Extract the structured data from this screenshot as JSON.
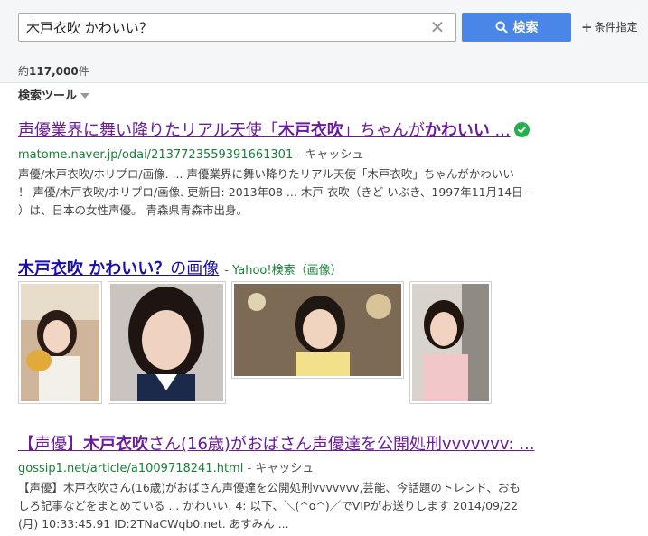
{
  "search": {
    "query": "木戸衣吹 かわいい？",
    "button_label": "検索",
    "conditions_label": "条件指定"
  },
  "results_count": {
    "prefix": "約",
    "number": "117,000",
    "suffix": "件"
  },
  "search_tools_label": "検索ツール",
  "results": [
    {
      "title_pre": "声優業界に舞い降りたリアル天使「",
      "title_b1": "木戸衣吹",
      "title_mid": "」ちゃんが",
      "title_b2": "かわいい",
      "title_post": " ...",
      "url": "matome.naver.jp/odai/2137723559391661301",
      "cache": "キャッシュ",
      "snippet": [
        "声優/木戸衣吹/ホリプロ/画像. ... 声優業界に舞い降りたリアル天使「木戸衣吹」ちゃんがかわいい",
        "！ 声優/木戸衣吹/ホリプロ/画像. 更新日: 2013年08 ... 木戸 衣吹（きど いぶき、1997年11月14日 -",
        "）は、日本の女性声優。 青森県青森市出身。"
      ]
    },
    {
      "title_pre": "【声優】",
      "title_b1": "木戸衣吹",
      "title_mid": "さん(16歳)がおばさん声優達を公開処刑vvvvvvv: ...",
      "url": "gossip1.net/article/a1009718241.html",
      "cache": "キャッシュ",
      "snippet": [
        "【声優】木戸衣吹さん(16歳)がおばさん声優達を公開処刑vvvvvvv,芸能、今話題のトレンド、おも",
        "しろ記事などをまとめている ... かわいい. 4: 以下、＼(^o^)／でVIPがお送りします 2014/09/22",
        "(月) 10:33:45.91 ID:2TNaCWqb0.net. あすみん ..."
      ]
    }
  ],
  "image_section": {
    "query": "木戸衣吹 かわいい？",
    "suffix": "の画像",
    "source": "- Yahoo!検索（画像）"
  },
  "colors": {
    "visited_link": "#6a1b9a",
    "link": "#1a0dab",
    "url_green": "#188038",
    "search_button": "#4a86e8"
  }
}
